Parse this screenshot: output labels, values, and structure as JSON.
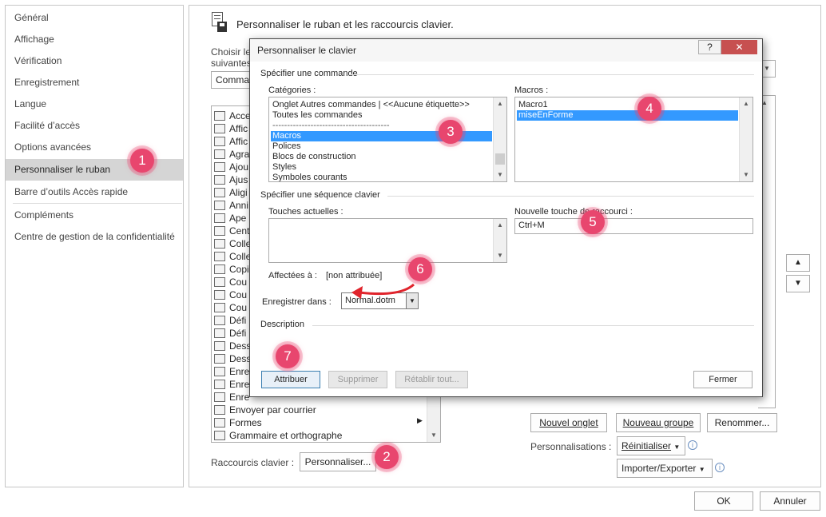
{
  "nav": {
    "items": [
      {
        "label": "Général"
      },
      {
        "label": "Affichage"
      },
      {
        "label": "Vérification"
      },
      {
        "label": "Enregistrement"
      },
      {
        "label": "Langue"
      },
      {
        "label": "Facilité d’accès"
      },
      {
        "label": "Options avancées"
      },
      {
        "label": "Personnaliser le ruban"
      },
      {
        "label": "Barre d’outils Accès rapide"
      },
      {
        "label": "Compléments"
      },
      {
        "label": "Centre de gestion de la confidentialité"
      }
    ]
  },
  "main": {
    "title": "Personnaliser le ruban et les raccourcis clavier.",
    "choose_label_1": "Choisir le",
    "choose_label_2": "suivantes",
    "choose_combo_value": "Comma",
    "commands": [
      "Acce",
      "Affic",
      "Affic",
      "Agra",
      "Ajou",
      "Ajus",
      "Aligi",
      "Anni",
      "Ape",
      "Cent",
      "Colle",
      "Colle",
      "Copi",
      "Cou",
      "Cou",
      "Cou",
      "Défi",
      "Défi",
      "Dess",
      "Dess",
      "Enre",
      "Enre",
      "Enre",
      "Envoyer par courrier",
      "Formes",
      "Grammaire et orthographe"
    ],
    "new_tab_label": "Nouvel onglet",
    "new_group_label": "Nouveau groupe",
    "rename_label": "Renommer...",
    "personalisations_label": "Personnalisations :",
    "reset_label": "Réinitialiser",
    "import_export_label": "Importer/Exporter",
    "shortcut_label": "Raccourcis clavier :",
    "customize_button": "Personnaliser...",
    "up_arrow": "▲",
    "down_arrow": "▼"
  },
  "footer": {
    "ok_label": "OK",
    "cancel_label": "Annuler"
  },
  "dialog": {
    "title": "Personnaliser le clavier",
    "help_icon": "?",
    "close_icon": "✕",
    "specify_command_label": "Spécifier une commande",
    "categories_label": "Catégories :",
    "categories": [
      "Onglet Autres commandes | <<Aucune étiquette>>",
      "Toutes les commandes",
      "----------------------------------------",
      "Macros",
      "Polices",
      "Blocs de construction",
      "Styles",
      "Symboles courants"
    ],
    "selected_category": "Macros",
    "macros_label": "Macros :",
    "macros": [
      "Macro1",
      "miseEnForme"
    ],
    "selected_macro": "miseEnForme",
    "key_sequence_label": "Spécifier une séquence clavier",
    "current_keys_label": "Touches actuelles :",
    "new_shortcut_label": "Nouvelle touche de raccourci :",
    "new_shortcut_value": "Ctrl+M",
    "assigned_to_label": "Affectées à :",
    "assigned_to_value": "[non attribuée]",
    "save_in_label": "Enregistrer dans :",
    "save_in_value": "Normal.dotm",
    "description_label": "Description",
    "assign_button": "Attribuer",
    "remove_button": "Supprimer",
    "reset_all_button": "Rétablir tout...",
    "close_button": "Fermer"
  },
  "badges": [
    "1",
    "2",
    "3",
    "4",
    "5",
    "6",
    "7"
  ],
  "colors": {
    "badge": "#e8466e",
    "selection": "#3399ff",
    "arrow": "#e0242c"
  }
}
